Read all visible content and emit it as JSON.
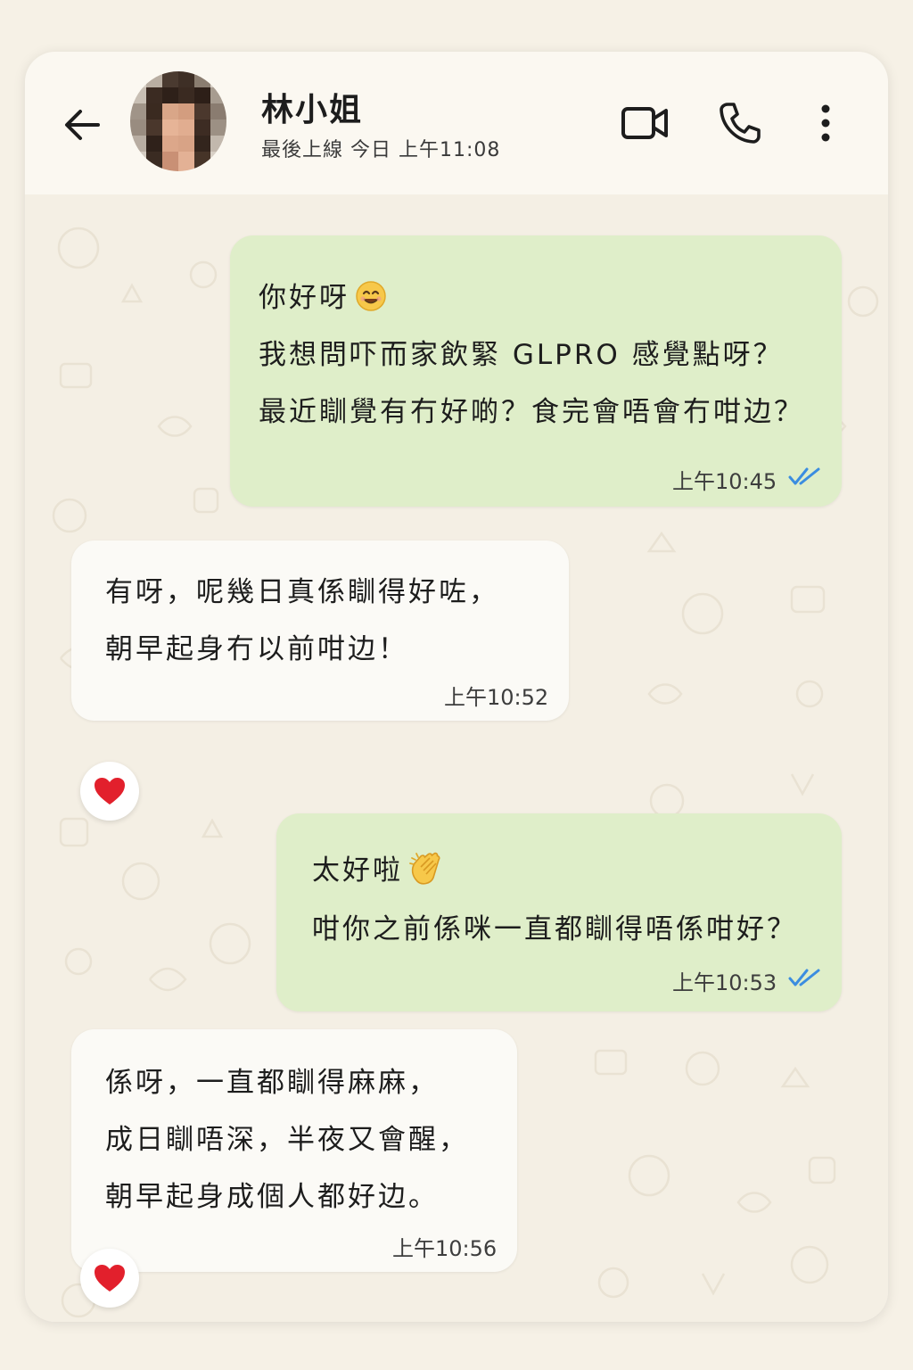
{
  "header": {
    "contact_name": "林小姐",
    "last_seen": "最後上線 今日 上午11:08"
  },
  "messages": [
    {
      "direction": "outgoing",
      "lines": [
        "你好呀",
        "我想問吓而家飲緊 GLPRO 感覺點呀？",
        "最近瞓覺有冇好啲？食完會唔會冇咁边？"
      ],
      "emoji": "smiling-face",
      "time": "上午10:45",
      "status": "read"
    },
    {
      "direction": "incoming",
      "lines": [
        "有呀，呢幾日真係瞓得好咗，",
        "朝早起身冇以前咁边！"
      ],
      "time": "上午10:52",
      "reaction": "heart"
    },
    {
      "direction": "outgoing",
      "lines": [
        "太好啦",
        "咁你之前係咪一直都瞓得唔係咁好？"
      ],
      "emoji": "clapping-hands",
      "time": "上午10:53",
      "status": "read"
    },
    {
      "direction": "incoming",
      "lines": [
        "係呀，一直都瞓得麻麻，",
        "成日瞓唔深，半夜又會醒，",
        "朝早起身成個人都好边。"
      ],
      "time": "上午10:56",
      "reaction": "heart"
    }
  ],
  "colors": {
    "outgoing_bubble": "#dfeec9",
    "incoming_bubble": "#fbfaf6",
    "read_ticks": "#3b8de0",
    "heart": "#e2202c"
  }
}
